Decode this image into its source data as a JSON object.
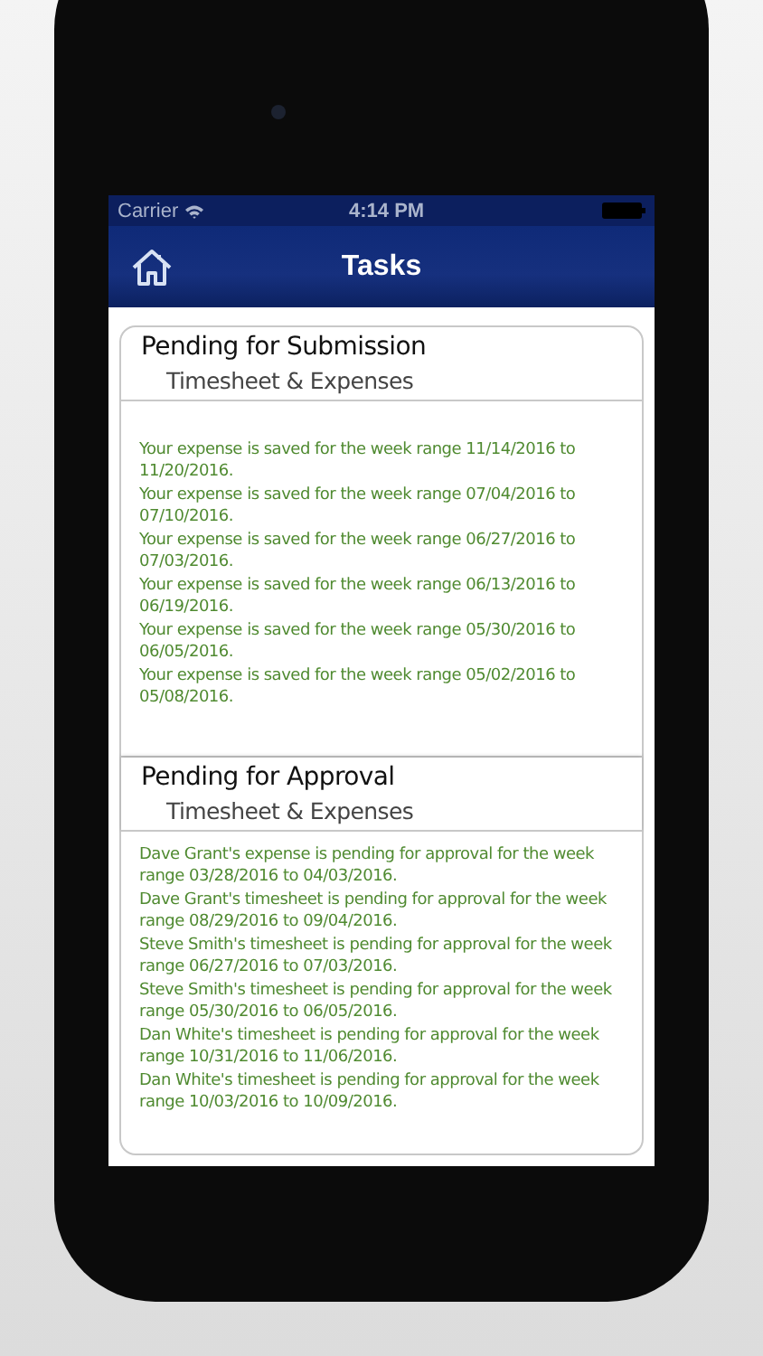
{
  "status_bar": {
    "carrier": "Carrier",
    "time": "4:14 PM"
  },
  "nav": {
    "title": "Tasks"
  },
  "sections": [
    {
      "title": "Pending for Submission",
      "subtitle": "Timesheet & Expenses",
      "items": [
        "Your expense is saved for the week range 11/14/2016 to 11/20/2016.",
        "Your expense is saved for the week range 07/04/2016 to 07/10/2016.",
        "Your expense is saved for the week range 06/27/2016 to 07/03/2016.",
        "Your expense is saved for the week range 06/13/2016 to 06/19/2016.",
        "Your expense is saved for the week range 05/30/2016 to 06/05/2016.",
        "Your expense is saved for the week range 05/02/2016 to 05/08/2016."
      ]
    },
    {
      "title": "Pending for Approval",
      "subtitle": "Timesheet & Expenses",
      "items": [
        "Dave Grant's expense is pending for approval for the week range 03/28/2016 to 04/03/2016.",
        "Dave Grant's timesheet is pending for approval for the week range 08/29/2016 to 09/04/2016.",
        "Steve Smith's timesheet is pending for approval for the week range 06/27/2016 to 07/03/2016.",
        "Steve Smith's timesheet is pending for approval for the week range 05/30/2016 to 06/05/2016.",
        "Dan White's timesheet is pending for approval for the week range 10/31/2016 to 11/06/2016.",
        "Dan White's timesheet is pending for approval for the week range 10/03/2016 to 10/09/2016."
      ]
    }
  ]
}
